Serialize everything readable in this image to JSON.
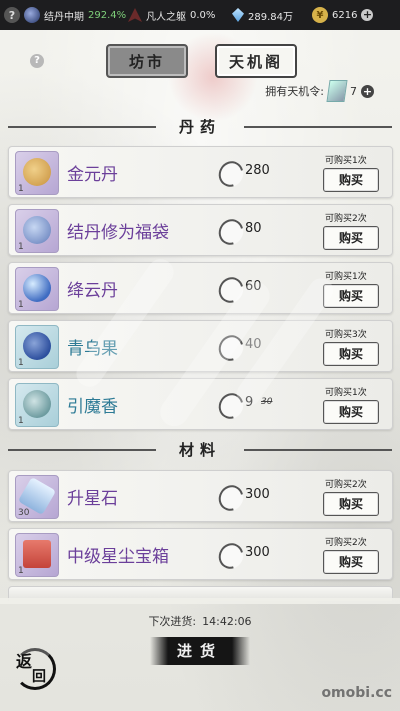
{
  "status_bar": {
    "help_glyph": "?",
    "realm": {
      "label": "结丹中期",
      "percent": "292.4%"
    },
    "body": {
      "label": "凡人之躯",
      "percent": "0.0%"
    },
    "spirit_stones": "289.84万",
    "coins": "6216",
    "plus": "+"
  },
  "help_glyph": "?",
  "tabs": {
    "market": "坊市",
    "tianji": "天机阁",
    "active": "market"
  },
  "token": {
    "label": "拥有天机令:",
    "count": "7",
    "plus": "+"
  },
  "sections": [
    {
      "title": "丹药",
      "items": [
        {
          "name": "金元丹",
          "qty": "1",
          "price": "280",
          "old_price": "",
          "limit": "可购买1次",
          "buy": "购买",
          "color": "purple",
          "art_color": "#c7903c"
        },
        {
          "name": "结丹修为福袋",
          "qty": "1",
          "price": "80",
          "old_price": "",
          "limit": "可购买2次",
          "buy": "购买",
          "color": "purple",
          "art_color": "#5e79b8"
        },
        {
          "name": "绛云丹",
          "qty": "1",
          "price": "60",
          "old_price": "",
          "limit": "可购买1次",
          "buy": "购买",
          "color": "purple",
          "art_color": "#3f6cc2"
        },
        {
          "name": "青乌果",
          "qty": "1",
          "price": "40",
          "old_price": "",
          "limit": "可购买3次",
          "buy": "购买",
          "color": "blue",
          "art_color": "#2d4f9e"
        },
        {
          "name": "引魔香",
          "qty": "1",
          "price": "9",
          "old_price": "30",
          "limit": "可购买1次",
          "buy": "购买",
          "color": "blue",
          "art_color": "#6e9ca0"
        }
      ]
    },
    {
      "title": "材料",
      "items": [
        {
          "name": "升星石",
          "qty": "30",
          "price": "300",
          "old_price": "",
          "limit": "可购买2次",
          "buy": "购买",
          "color": "purple",
          "art_color": "#8fb4de"
        },
        {
          "name": "中级星尘宝箱",
          "qty": "1",
          "price": "300",
          "old_price": "",
          "limit": "可购买2次",
          "buy": "购买",
          "color": "purple",
          "art_color": "#c4433a"
        }
      ]
    }
  ],
  "footer": {
    "next_restock_label": "下次进货:",
    "next_restock_time": "14:42:06",
    "restock_button": "进货",
    "back_top": "返",
    "back_bottom": "回"
  },
  "watermark": "omobi.cc"
}
